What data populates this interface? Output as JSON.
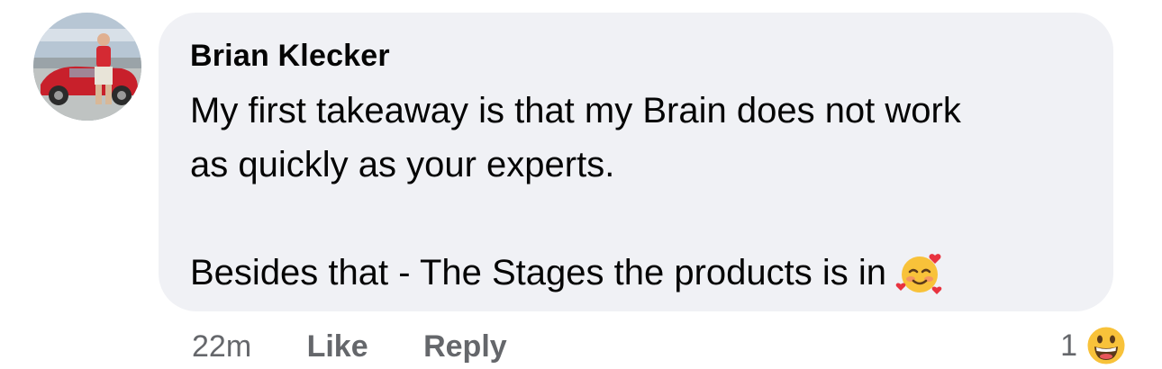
{
  "comment": {
    "author": "Brian Klecker",
    "lines": [
      "My first takeaway is that my Brain does not work",
      "as quickly as your experts.",
      "Besides that - The Stages the products is in"
    ],
    "inline_emoji": "smiling-face-with-hearts-icon"
  },
  "actions": {
    "timestamp": "22m",
    "like_label": "Like",
    "reply_label": "Reply"
  },
  "reactions": {
    "count": "1",
    "emoji": "grinning-face-icon"
  },
  "colors": {
    "bubble": "#f0f1f5",
    "text": "#050505",
    "secondary": "#65676b"
  }
}
